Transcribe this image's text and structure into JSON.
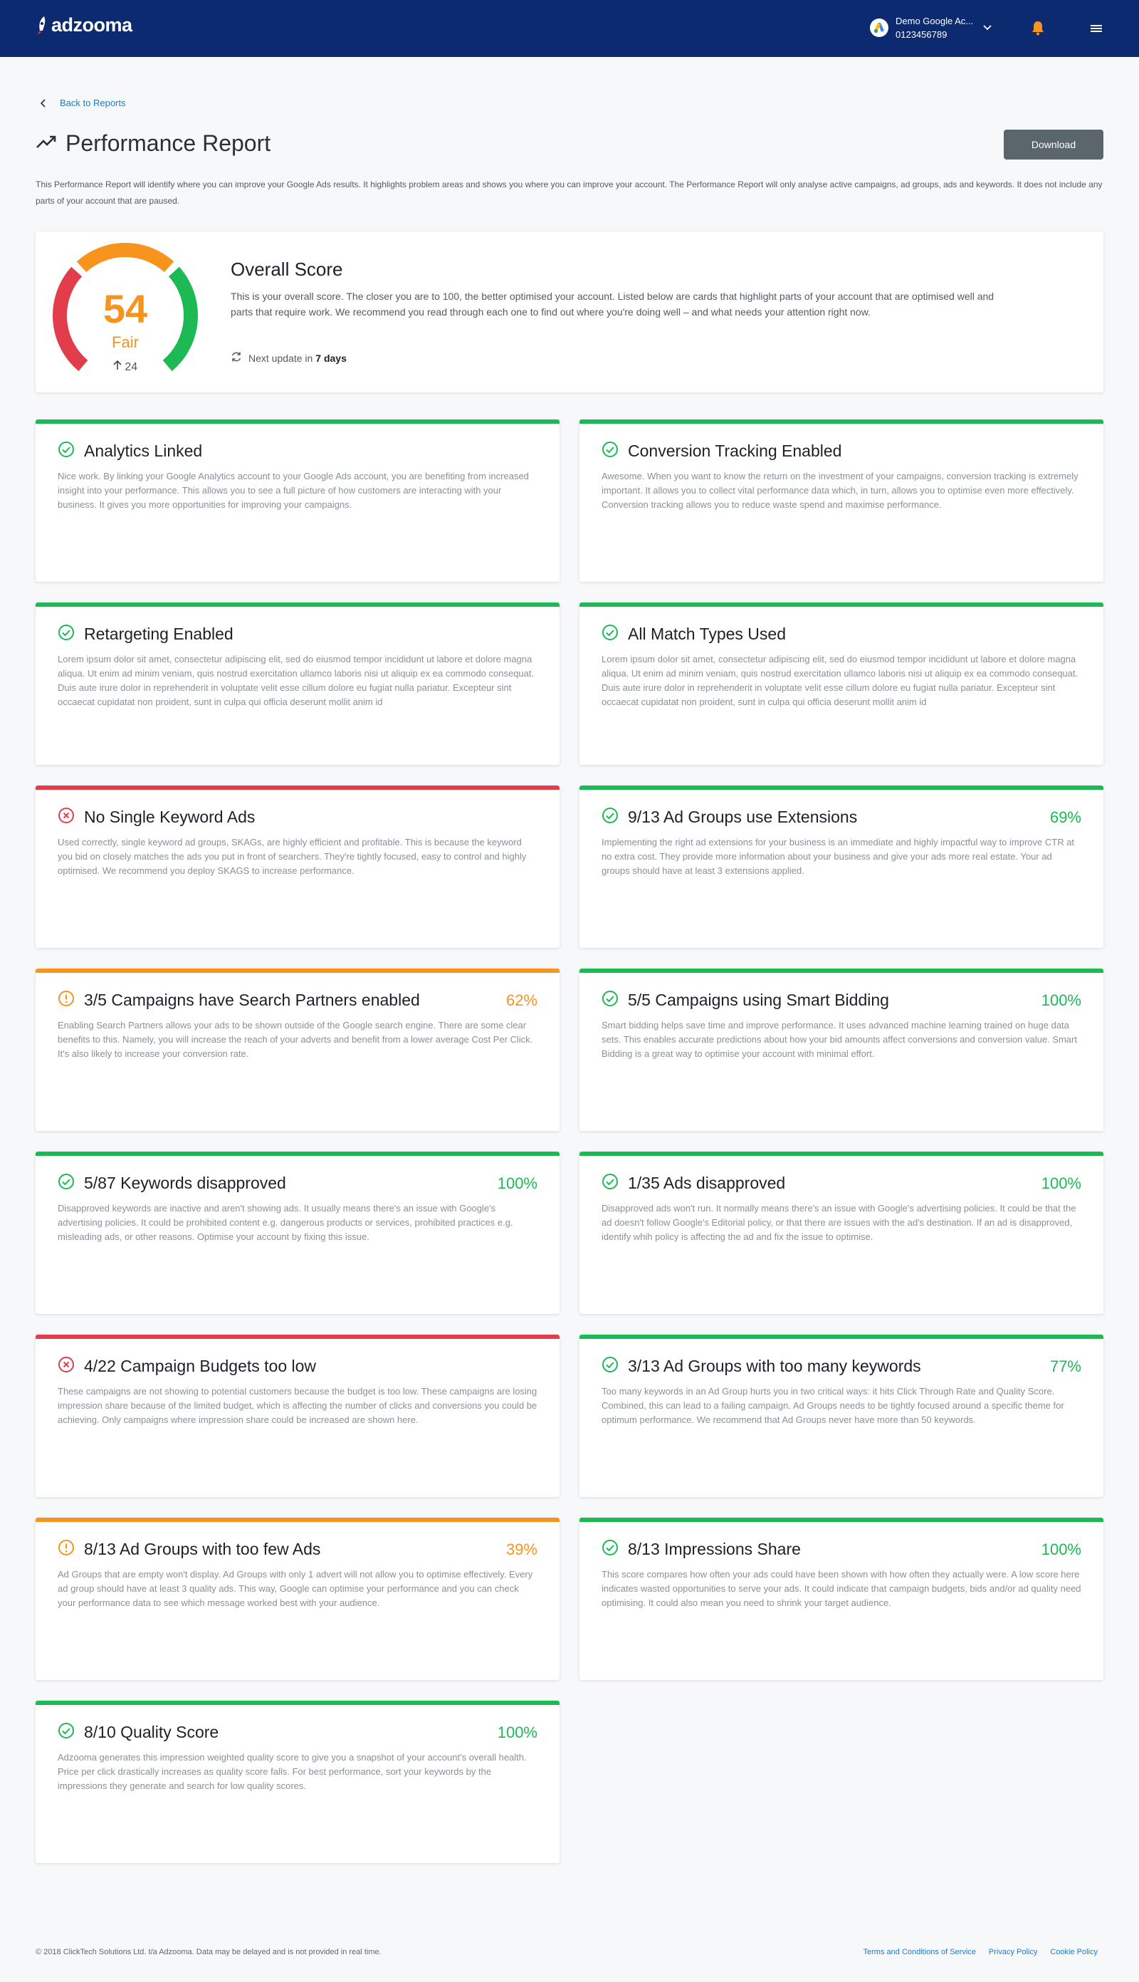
{
  "header": {
    "logo_text": "adzooma",
    "account_name": "Demo Google Ac...",
    "account_id": "0123456789"
  },
  "back_link": "Back to Reports",
  "page_title": "Performance Report",
  "download_label": "Download",
  "intro": "This Performance Report will identify where you can improve your Google Ads results. It highlights problem areas and shows you where you can improve your account. The Performance Report will only analyse active campaigns, ad groups, ads and keywords. It does not include any parts of your account that are paused.",
  "overall": {
    "score": "54",
    "score_value": 54,
    "rating": "Fair",
    "delta": "24",
    "title": "Overall Score",
    "text": "This is your overall score. The closer you are to 100, the better optimised your account. Listed below are cards that highlight parts of your account that are optimised well and parts that require work. We recommend you read through each one to find out where you're doing well – and what needs your attention right now.",
    "update_prefix": "Next update in",
    "update_value": "7 days"
  },
  "colors": {
    "good": "#1db954",
    "warning": "#f7941d",
    "bad": "#e23d4b",
    "header": "#0b2a6f",
    "link": "#1f7ac9"
  },
  "cards": [
    {
      "title": "Analytics Linked",
      "percent": "",
      "status": "good",
      "icon": "check-circle-icon",
      "text": "Nice work. By linking your Google Analytics account to your Google Ads account, you are benefiting from increased insight into your performance. This allows you to see a full picture of how customers are interacting with your business. It gives you more opportunities for improving your campaigns."
    },
    {
      "title": "Conversion Tracking Enabled",
      "percent": "",
      "status": "good",
      "icon": "check-circle-icon",
      "text": "Awesome. When you want to know the return on the investment of your campaigns, conversion tracking is extremely important. It allows you to collect vital performance data which, in turn, allows you to optimise even more effectively. Conversion tracking allows you to reduce waste spend and maximise performance."
    },
    {
      "title": "Retargeting Enabled",
      "percent": "",
      "status": "good",
      "icon": "check-circle-icon",
      "text": "Lorem ipsum dolor sit amet, consectetur adipiscing elit, sed do eiusmod tempor incididunt ut labore et dolore magna aliqua. Ut enim ad minim veniam, quis nostrud exercitation ullamco laboris nisi ut aliquip ex ea commodo consequat. Duis aute irure dolor in reprehenderit in voluptate velit esse cillum dolore eu fugiat nulla pariatur. Excepteur sint occaecat cupidatat non proident, sunt in culpa qui officia deserunt mollit anim id"
    },
    {
      "title": "All Match Types Used",
      "percent": "",
      "status": "good",
      "icon": "check-circle-icon",
      "text": "Lorem ipsum dolor sit amet, consectetur adipiscing elit, sed do eiusmod tempor incididunt ut labore et dolore magna aliqua. Ut enim ad minim veniam, quis nostrud exercitation ullamco laboris nisi ut aliquip ex ea commodo consequat. Duis aute irure dolor in reprehenderit in voluptate velit esse cillum dolore eu fugiat nulla pariatur. Excepteur sint occaecat cupidatat non proident, sunt in culpa qui officia deserunt mollit anim id"
    },
    {
      "title": "No Single Keyword Ads",
      "percent": "",
      "status": "bad",
      "icon": "x-circle-icon",
      "text": "Used correctly, single keyword ad groups, SKAGs, are highly efficient and profitable. This is because the keyword you bid on closely matches the ads you put in front of searchers. They're tightly focused, easy to control and highly optimised. We recommend you deploy SKAGS to increase performance."
    },
    {
      "title": "9/13 Ad Groups use Extensions",
      "percent": "69%",
      "status": "good",
      "icon": "check-circle-icon",
      "text": "Implementing the right ad extensions for your business is an immediate and highly impactful way to improve CTR at no extra cost. They provide more information about your business and give your ads more real estate. Your ad groups should have at least 3 extensions applied."
    },
    {
      "title": "3/5 Campaigns have Search Partners enabled",
      "percent": "62%",
      "status": "warning",
      "icon": "alert-circle-icon",
      "text": "Enabling Search Partners allows your ads to be shown outside of the Google search engine. There are some clear benefits to this. Namely, you will increase the reach of your adverts and benefit from a lower average Cost Per Click. It's also likely to increase your conversion rate."
    },
    {
      "title": "5/5 Campaigns using Smart Bidding",
      "percent": "100%",
      "status": "good",
      "icon": "check-circle-icon",
      "text": "Smart bidding helps save time and improve performance. It uses advanced machine learning trained on huge data sets. This enables accurate predictions about how your bid amounts affect conversions and conversion value. Smart Bidding is a great way to optimise your account with minimal effort."
    },
    {
      "title": "5/87 Keywords disapproved",
      "percent": "100%",
      "status": "good",
      "icon": "check-circle-icon",
      "text": "Disapproved keywords are inactive and aren't showing ads. It usually means there's an issue with Google's advertising policies. It could be prohibited content e.g. dangerous products or services, prohibited practices e.g. misleading ads, or other reasons. Optimise your account by fixing this issue."
    },
    {
      "title": "1/35 Ads disapproved",
      "percent": "100%",
      "status": "good",
      "icon": "check-circle-icon",
      "text": "Disapproved ads won't run. It normally means there's an issue with Google's advertising policies. It could be that the ad doesn't follow Google's Editorial policy, or that there are issues with the ad's destination. If an ad is disapproved, identify whih policy is affecting the ad and fix the issue to optimise."
    },
    {
      "title": "4/22 Campaign Budgets too low",
      "percent": "",
      "status": "bad",
      "icon": "x-circle-icon",
      "text": "These campaigns are not showing to potential customers because the budget is too low. These campaigns are losing impression share because of the limited budget, which is affecting the number of clicks and conversions you could be achieving. Only campaigns where impression share could be increased are shown here."
    },
    {
      "title": "3/13 Ad Groups with too many keywords",
      "percent": "77%",
      "status": "good",
      "icon": "check-circle-icon",
      "text": "Too many keywords in an Ad Group hurts you in two critical ways: it hits Click Through Rate and Quality Score. Combined, this can lead to a failing campaign. Ad Groups needs to be tightly focused around a specific theme for optimum performance. We recommend that Ad Groups never have more than 50 keywords."
    },
    {
      "title": "8/13 Ad Groups with too few Ads",
      "percent": "39%",
      "status": "warning",
      "icon": "alert-circle-icon",
      "text": "Ad Groups that are empty won't display. Ad Groups with only 1 advert will not allow you to optimise effectively. Every ad group should have at least 3 quality ads. This way, Google can optimise your performance and you can check your performance data to see which message worked best with your audience."
    },
    {
      "title": "8/13 Impressions Share",
      "percent": "100%",
      "status": "good",
      "icon": "check-circle-icon",
      "text": "This score compares how often your ads could have been shown with how often they actually were. A low score here indicates wasted opportunities to serve your ads. It could indicate that campaign budgets, bids and/or ad quality need optimising. It could also mean you need to shrink your target audience."
    },
    {
      "title": "8/10 Quality Score",
      "percent": "100%",
      "status": "good",
      "icon": "check-circle-icon",
      "text": "Adzooma generates this impression weighted quality score to give you a snapshot of your account's overall health. Price per click drastically increases as quality score falls. For best performance, sort your keywords by the impressions they generate and search for low quality scores."
    }
  ],
  "footer": {
    "copyright": "© 2018 ClickTech Solutions Ltd. t/a Adzooma. Data may be delayed and is not provided in real time.",
    "terms": "Terms and Conditions of Service",
    "privacy": "Privacy Policy",
    "cookie": "Cookie Policy"
  }
}
